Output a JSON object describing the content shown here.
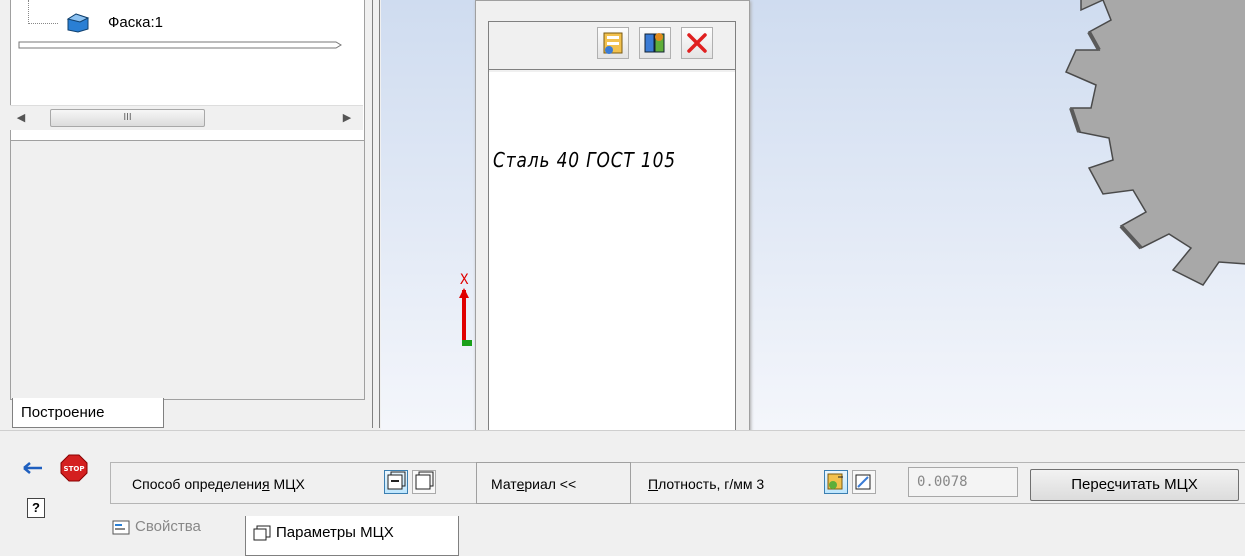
{
  "tree": {
    "item_label": "Фаска:1",
    "scroll_thumb_grip": "III"
  },
  "left_tab": {
    "label": "Построение"
  },
  "popup": {
    "toolbar": [
      "library-book-icon",
      "material-db-icon",
      "close-red-x-icon"
    ],
    "material_text": "Сталь 40  ГОСТ 105"
  },
  "viewport": {
    "axis_label": "X"
  },
  "property_bar": {
    "method_label_pre": "Способ определени",
    "method_label_mn": "я",
    "method_label_post": " МЦХ",
    "material_button": "Мат",
    "material_button_mn": "е",
    "material_button_post": "риал  <<",
    "density_label_mn": "П",
    "density_label_post": "лотность, г/мм 3",
    "density_value": "0.0078",
    "recalc_pre": "Пере",
    "recalc_mn": "с",
    "recalc_post": "читать МЦХ"
  },
  "bottom_tabs": {
    "properties": "Свойства",
    "mass_params": "Параметры МЦХ"
  },
  "colors": {
    "stop": "#d42020",
    "close": "#e02020",
    "axis_x": "#e00000",
    "gear": "#a8a8a8"
  }
}
